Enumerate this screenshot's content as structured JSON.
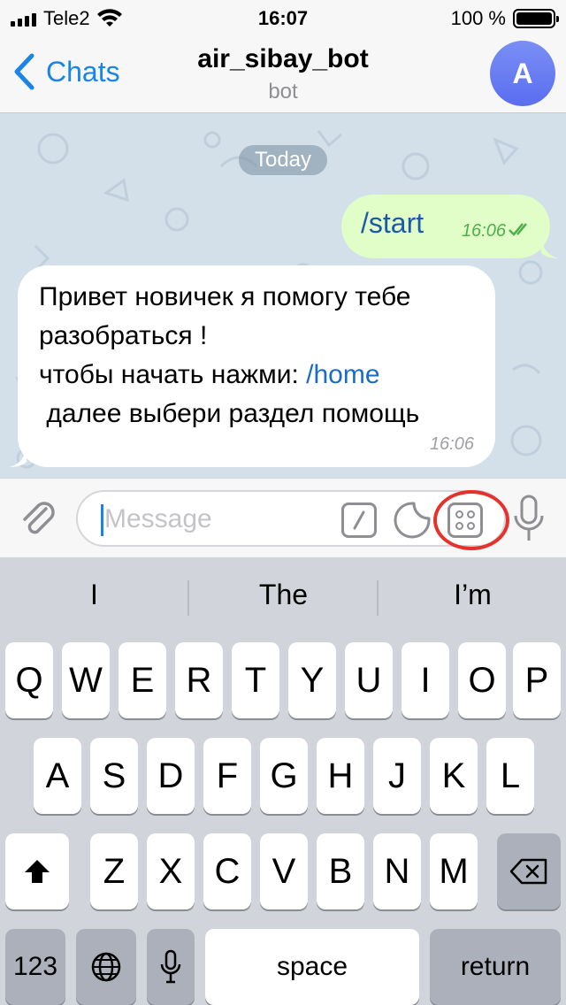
{
  "status_bar": {
    "carrier": "Tele2",
    "time": "16:07",
    "battery": "100 %"
  },
  "nav": {
    "back_label": "Chats",
    "title": "air_sibay_bot",
    "subtitle": "bot",
    "avatar_letter": "A"
  },
  "chat": {
    "date_divider": "Today",
    "outgoing": {
      "text": "/start",
      "time": "16:06"
    },
    "incoming": {
      "line1": "Привет новичек я помогу тебе",
      "line2": "разобраться !",
      "line3_prefix": "чтобы начать нажми: ",
      "line3_link": "/home",
      "line4": " далее выбери раздел помощь",
      "time": "16:06"
    }
  },
  "input": {
    "placeholder": "Message"
  },
  "keyboard": {
    "predictions": [
      "I",
      "The",
      "I’m"
    ],
    "row1": [
      "Q",
      "W",
      "E",
      "R",
      "T",
      "Y",
      "U",
      "I",
      "O",
      "P"
    ],
    "row2": [
      "A",
      "S",
      "D",
      "F",
      "G",
      "H",
      "J",
      "K",
      "L"
    ],
    "row3": [
      "Z",
      "X",
      "C",
      "V",
      "B",
      "N",
      "M"
    ],
    "numbers_key": "123",
    "space_key": "space",
    "return_key": "return"
  },
  "colors": {
    "accent": "#1a85e6",
    "outgoing_bubble": "#e2fec8",
    "chat_background": "#d3dfe9",
    "highlight_ring": "#e4322d"
  }
}
